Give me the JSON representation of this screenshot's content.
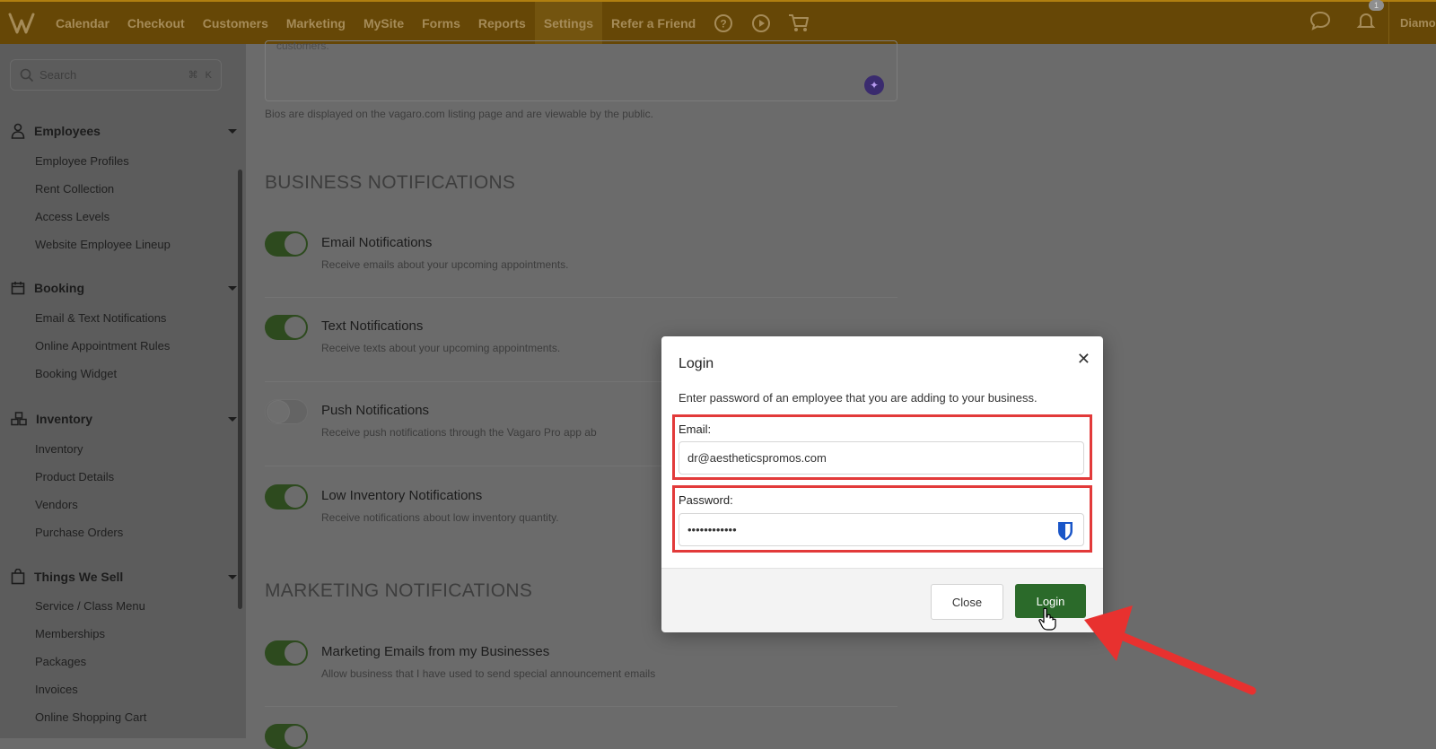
{
  "topbar": {
    "nav": [
      "Calendar",
      "Checkout",
      "Customers",
      "Marketing",
      "MySite",
      "Forms",
      "Reports",
      "Settings",
      "Refer a Friend"
    ],
    "active": "Settings",
    "icons": [
      "help-icon",
      "play-icon",
      "cart-icon",
      "chat-icon",
      "bell-icon"
    ],
    "notification_count": "1",
    "user_name": "Diamo"
  },
  "sidebar": {
    "search_placeholder": "Search",
    "search_shortcut": [
      "⌘",
      "K"
    ],
    "groups": [
      {
        "title": "Employees",
        "icon": "person-icon",
        "items": [
          "Employee Profiles",
          "Rent Collection",
          "Access Levels",
          "Website Employee Lineup"
        ]
      },
      {
        "title": "Booking",
        "icon": "calendar-icon",
        "items": [
          "Email & Text Notifications",
          "Online Appointment Rules",
          "Booking Widget"
        ]
      },
      {
        "title": "Inventory",
        "icon": "boxes-icon",
        "items": [
          "Inventory",
          "Product Details",
          "Vendors",
          "Purchase Orders"
        ]
      },
      {
        "title": "Things We Sell",
        "icon": "bag-icon",
        "items": [
          "Service / Class Menu",
          "Memberships",
          "Packages",
          "Invoices",
          "Online Shopping Cart"
        ]
      }
    ]
  },
  "main": {
    "bio_text": "customers.",
    "bio_hint": "Bios are displayed on the vagaro.com listing page and are viewable by the public.",
    "business_heading": "BUSINESS NOTIFICATIONS",
    "business_rows": [
      {
        "title": "Email Notifications",
        "desc": "Receive emails about your upcoming appointments.",
        "on": true
      },
      {
        "title": "Text Notifications",
        "desc": "Receive texts about your upcoming appointments.",
        "on": true
      },
      {
        "title": "Push Notifications",
        "desc": "Receive push notifications through the Vagaro Pro app ab",
        "on": false
      },
      {
        "title": "Low Inventory Notifications",
        "desc": "Receive notifications about low inventory quantity.",
        "on": true
      }
    ],
    "marketing_heading": "MARKETING NOTIFICATIONS",
    "marketing_rows": [
      {
        "title": "Marketing Emails from my Businesses",
        "desc": "Allow business that I have used to send special announcement emails",
        "on": true
      }
    ]
  },
  "modal": {
    "title": "Login",
    "close_glyph": "✕",
    "description": "Enter password of an employee that you are adding to your business.",
    "email_label": "Email:",
    "email_value": "dr@aestheticspromos.com",
    "password_label": "Password:",
    "password_value": "••••••••••••",
    "close_button": "Close",
    "login_button": "Login"
  },
  "colors": {
    "topbar": "#664706",
    "accent_green": "#2b6a2a",
    "highlight_red": "#e23a3a"
  }
}
